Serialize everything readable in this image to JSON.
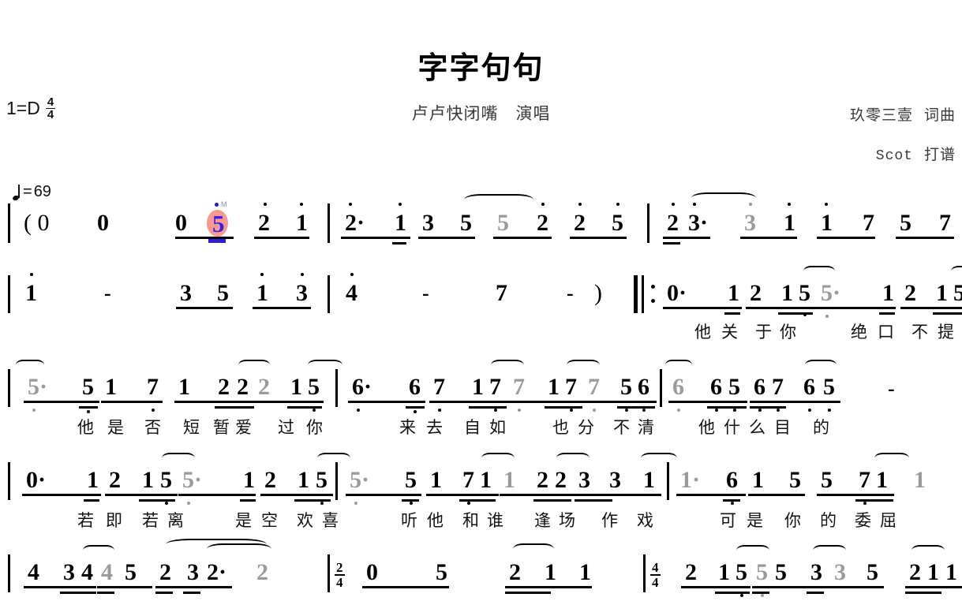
{
  "document": {
    "type": "jianpu-score",
    "title": "字字句句",
    "performer": "卢卢快闭嘴　演唱",
    "credits": [
      {
        "name": "玖零三壹",
        "role": "词曲"
      },
      {
        "name": "Scot",
        "role": "打谱"
      }
    ],
    "key_signature": "1=D",
    "time_signature": {
      "numerator": "4",
      "denominator": "4"
    },
    "tempo": {
      "note": "quarter-note",
      "equals": "=",
      "bpm": "69"
    }
  },
  "highlight": {
    "note": "5",
    "color_fill": "#f4948c",
    "color_text": "#3b1fe0",
    "tag": "M"
  },
  "rows": [
    {
      "id": "row-1",
      "notes": [
        "( 0",
        "0",
        "0",
        "5",
        "2",
        "1",
        "2·",
        "1",
        "3",
        "5",
        "5",
        "2",
        "2",
        "5",
        "2",
        "3·",
        "3",
        "1",
        "1",
        "7",
        "5",
        "7"
      ],
      "lyrics": []
    },
    {
      "id": "row-2",
      "notes": [
        "1",
        "-",
        "3",
        "5",
        "1",
        "3",
        "4",
        "-",
        "7",
        "-",
        ")",
        "0·",
        "1",
        "2",
        "1",
        "5",
        "5·",
        "1",
        "2",
        "1",
        "5"
      ],
      "lyrics": [
        "他",
        "关",
        "于",
        "你",
        "绝",
        "口",
        "不",
        "提"
      ]
    },
    {
      "id": "row-3",
      "notes": [
        "5·",
        "5",
        "1",
        "7",
        "1",
        "2",
        "2",
        "2",
        "1",
        "5",
        "6·",
        "6",
        "7",
        "1",
        "7",
        "7",
        "1",
        "7",
        "7",
        "5",
        "6",
        "6",
        "6",
        "5",
        "6",
        "7",
        "6",
        "5",
        "-"
      ],
      "lyrics": [
        "他",
        "是",
        "否",
        "短",
        "暂",
        "爱",
        "过",
        "你",
        "来",
        "去",
        "自",
        "如",
        "也",
        "分",
        "不",
        "清",
        "他",
        "什",
        "么",
        "目",
        "的"
      ]
    },
    {
      "id": "row-4",
      "notes": [
        "0·",
        "1",
        "2",
        "1",
        "5",
        "5·",
        "1",
        "2",
        "1",
        "5",
        "5·",
        "5",
        "1",
        "7",
        "1",
        "1",
        "2",
        "2",
        "3",
        "3",
        "1",
        "1·",
        "6",
        "1",
        "5",
        "5",
        "7",
        "1",
        "1"
      ],
      "lyrics": [
        "若",
        "即",
        "若",
        "离",
        "是",
        "空",
        "欢",
        "喜",
        "听",
        "他",
        "和",
        "谁",
        "逢",
        "场",
        "作",
        "戏",
        "可",
        "是",
        "你",
        "的",
        "委",
        "屈"
      ]
    },
    {
      "id": "row-5",
      "notes": [
        "4",
        "3",
        "4",
        "4",
        "5",
        "2",
        "3",
        "2·",
        "2",
        "0",
        "5",
        "2",
        "1",
        "1",
        "2",
        "1",
        "5",
        "5",
        "5",
        "3",
        "3",
        "5",
        "2",
        "1",
        "1"
      ],
      "inline_time_signatures": [
        {
          "numerator": "2",
          "denominator": "4"
        },
        {
          "numerator": "4",
          "denominator": "4"
        }
      ],
      "lyrics": []
    }
  ]
}
